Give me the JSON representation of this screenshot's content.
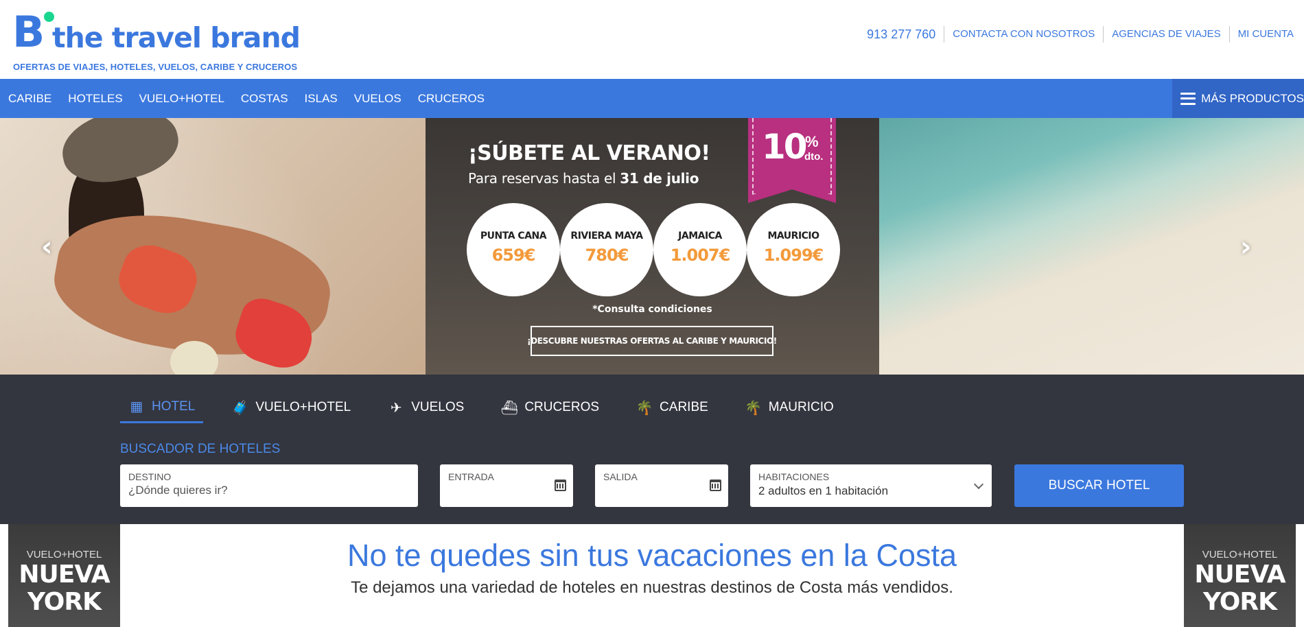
{
  "header": {
    "logo_letter": "B",
    "logo_text": "the travel brand",
    "tagline": "OFERTAS DE VIAJES, HOTELES, VUELOS, CARIBE Y CRUCEROS",
    "phone": "913 277 760",
    "links": [
      "CONTACTA CON NOSOTROS",
      "AGENCIAS DE VIAJES",
      "MI CUENTA"
    ]
  },
  "nav": {
    "items": [
      "CARIBE",
      "HOTELES",
      "VUELO+HOTEL",
      "COSTAS",
      "ISLAS",
      "VUELOS",
      "CRUCEROS"
    ],
    "more": "MÁS PRODUCTOS"
  },
  "hero": {
    "title": "¡SÚBETE AL VERANO!",
    "subtitle_prefix": "Para reservas hasta el",
    "subtitle_date": "31 de julio",
    "discount_value": "10",
    "discount_symbol": "%",
    "discount_suffix": "dto.",
    "offers": [
      {
        "name": "PUNTA CANA",
        "price": "659€"
      },
      {
        "name": "RIVIERA MAYA",
        "price": "780€"
      },
      {
        "name": "JAMAICA",
        "price": "1.007€"
      },
      {
        "name": "MAURICIO",
        "price": "1.099€"
      }
    ],
    "conditions": "*Consulta condiciones",
    "cta": "¡DESCUBRE NUESTRAS OFERTAS AL CARIBE Y MAURICIO!",
    "prev_arrow": "‹",
    "next_arrow": "›"
  },
  "search": {
    "tabs": [
      {
        "label": "HOTEL",
        "icon": "building-icon",
        "glyph": "▦"
      },
      {
        "label": "VUELO+HOTEL",
        "icon": "suitcase-icon",
        "glyph": "🧳"
      },
      {
        "label": "VUELOS",
        "icon": "plane-icon",
        "glyph": "✈"
      },
      {
        "label": "CRUCEROS",
        "icon": "ship-icon",
        "glyph": "⛴"
      },
      {
        "label": "CARIBE",
        "icon": "palm-icon",
        "glyph": "🌴"
      },
      {
        "label": "MAURICIO",
        "icon": "palm-icon",
        "glyph": "🌴"
      }
    ],
    "active_tab": "HOTEL",
    "title": "BUSCADOR DE HOTELES",
    "destino_label": "DESTINO",
    "destino_placeholder": "¿Dónde quieres ir?",
    "entrada_label": "ENTRADA",
    "salida_label": "SALIDA",
    "habitaciones_label": "HABITACIONES",
    "habitaciones_value": "2 adultos en 1 habitación",
    "button": "BUSCAR HOTEL"
  },
  "promo": {
    "headline": "No te quedes sin tus vacaciones en la Costa",
    "subline": "Te dejamos una variedad de hoteles en nuestras destinos de Costa más vendidos.",
    "banner_small": "VUELO+HOTEL",
    "banner_big_1": "NUEVA",
    "banner_big_2": "YORK"
  },
  "colors": {
    "brand_blue": "#3b78de",
    "brand_green": "#19d68e",
    "search_bg": "#33353f",
    "offer_orange": "#f39a3b",
    "ribbon_magenta": "#b8307f"
  }
}
